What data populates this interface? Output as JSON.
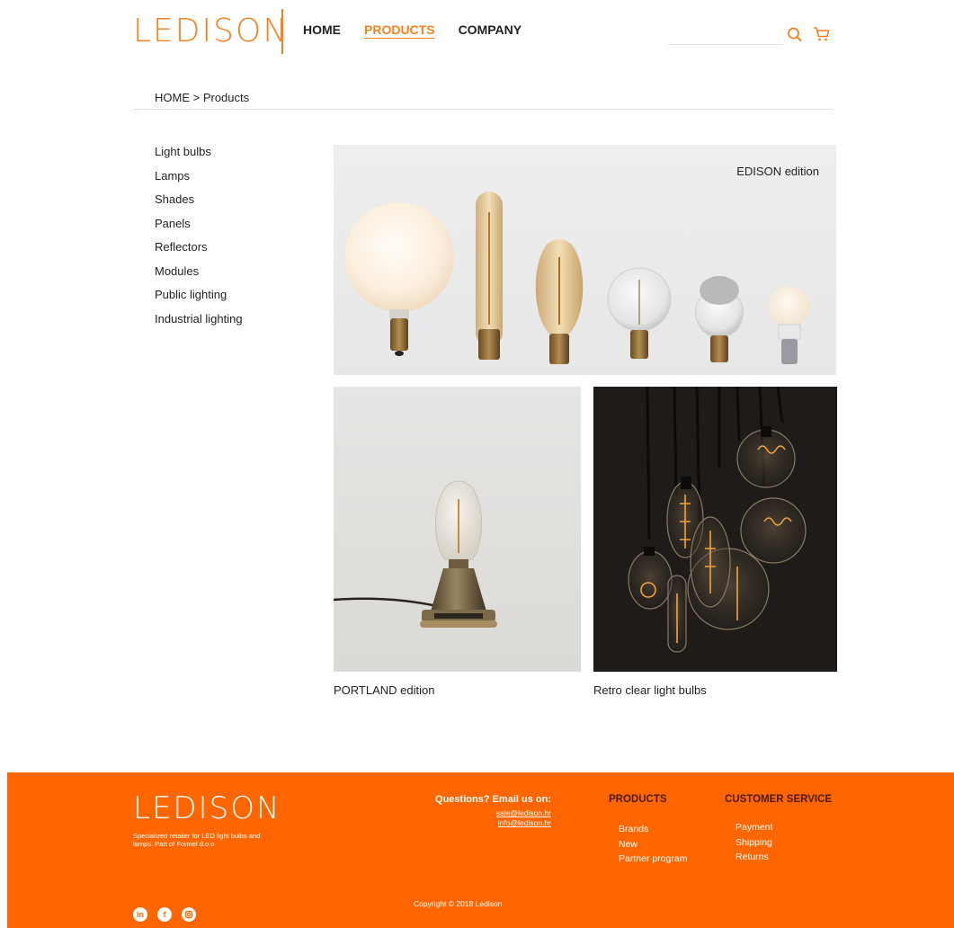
{
  "brand": {
    "logo": "LEDISON",
    "accent_color": "#f58220",
    "footer_color": "#ff6600"
  },
  "nav": {
    "items": [
      "HOME",
      "PRODUCTS",
      "COMPANY"
    ],
    "active": "PRODUCTS"
  },
  "search": {
    "placeholder": "",
    "value": "",
    "icon": "search-icon"
  },
  "cart": {
    "icon": "cart-icon"
  },
  "breadcrumb": "HOME > Products",
  "sidebar": {
    "items": [
      "Light bulbs",
      "Lamps",
      "Shades",
      "Panels",
      "Reflectors",
      "Modules",
      "Public lighting",
      "Industrial lighting"
    ]
  },
  "products": {
    "hero_caption": "EDISON edition",
    "tile_left_caption": "PORTLAND edition",
    "tile_right_caption": "Retro clear light bulbs"
  },
  "footer": {
    "logo": "LEDISON",
    "tagline": "Specialized retailer for LED light bulbs and lamps. Part of Formel d.o.o",
    "questions": "Questions? Email us on:",
    "emails": [
      "sale@ledison.hr",
      "info@ledison.hr"
    ],
    "products_title": "PRODUCTS",
    "products_links": [
      "Brands",
      "New",
      "Partner program"
    ],
    "service_title": "CUSTOMER SERVICE",
    "service_links": [
      "Payment",
      "Shipping",
      "Returns"
    ],
    "social": [
      "in",
      "f",
      "ig"
    ],
    "social_icons": [
      "linkedin-icon",
      "facebook-icon",
      "instagram-icon"
    ],
    "copyright": "Copyright © 2018 Ledison"
  }
}
